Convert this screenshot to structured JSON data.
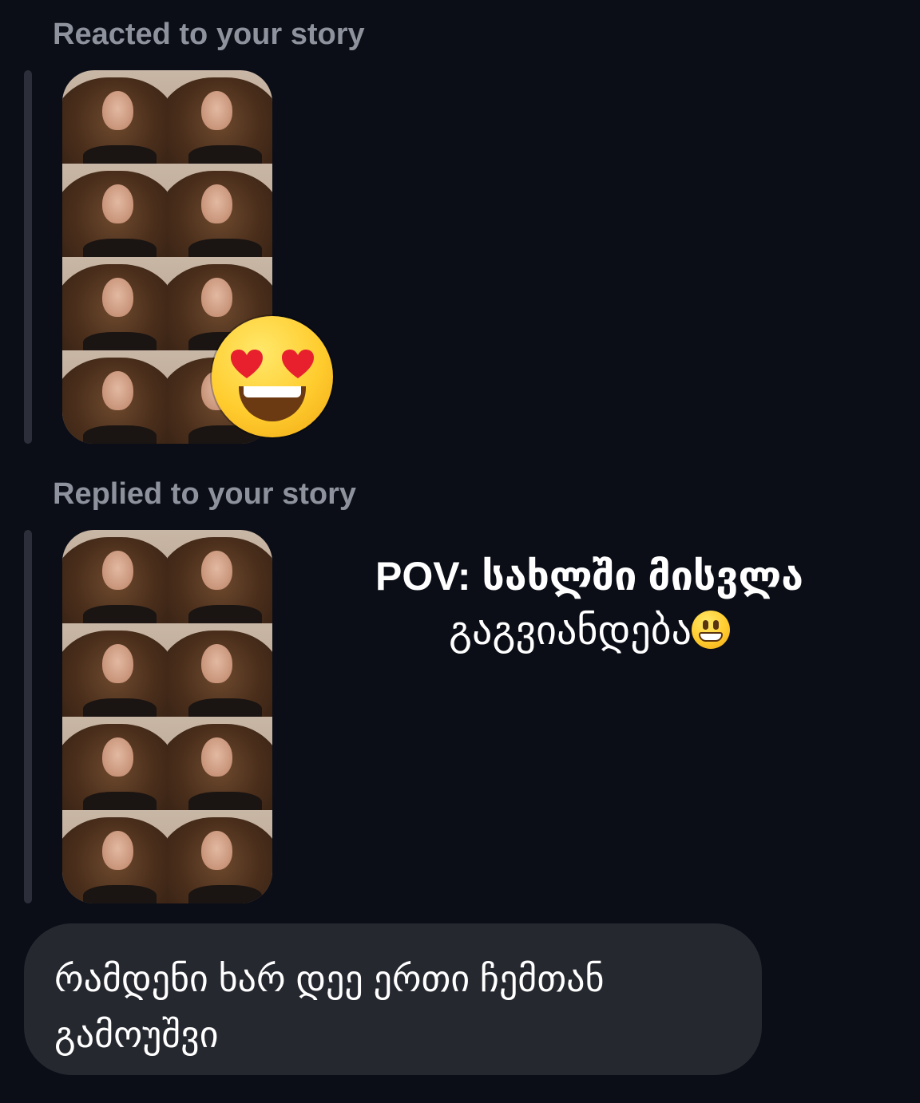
{
  "reaction": {
    "label": "Reacted to your story",
    "emoji_icon": "heart-eyes-emoji-icon"
  },
  "reply": {
    "label": "Replied to your story",
    "story_overlay": {
      "line1": "POV: სახლში მისვლა",
      "line2": "გაგვიანდება",
      "emoji_icon": "grinning-face-emoji-icon"
    }
  },
  "message": {
    "text": "რამდენი ხარ დეე ერთი ჩემთან გამოუშვი"
  },
  "colors": {
    "background": "#0b0e17",
    "label": "#8e929c",
    "bubble": "#25282f",
    "bar": "#2c2f39"
  }
}
